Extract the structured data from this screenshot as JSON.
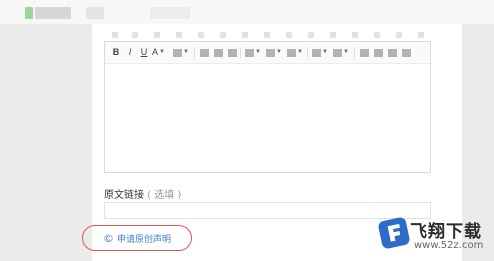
{
  "editor": {
    "toolbar": {
      "bold": "B",
      "italic": "I",
      "underline": "U",
      "font_color": "A"
    }
  },
  "source": {
    "label": "原文链接",
    "optional": "( 选填 )",
    "value": ""
  },
  "declare": {
    "icon": "copyright-icon",
    "label": "申请原创声明",
    "highlight_color": "#e05555",
    "link_color": "#3d7fcf"
  },
  "watermark": {
    "title": "飞翔下载",
    "url": "www.52z.com"
  }
}
